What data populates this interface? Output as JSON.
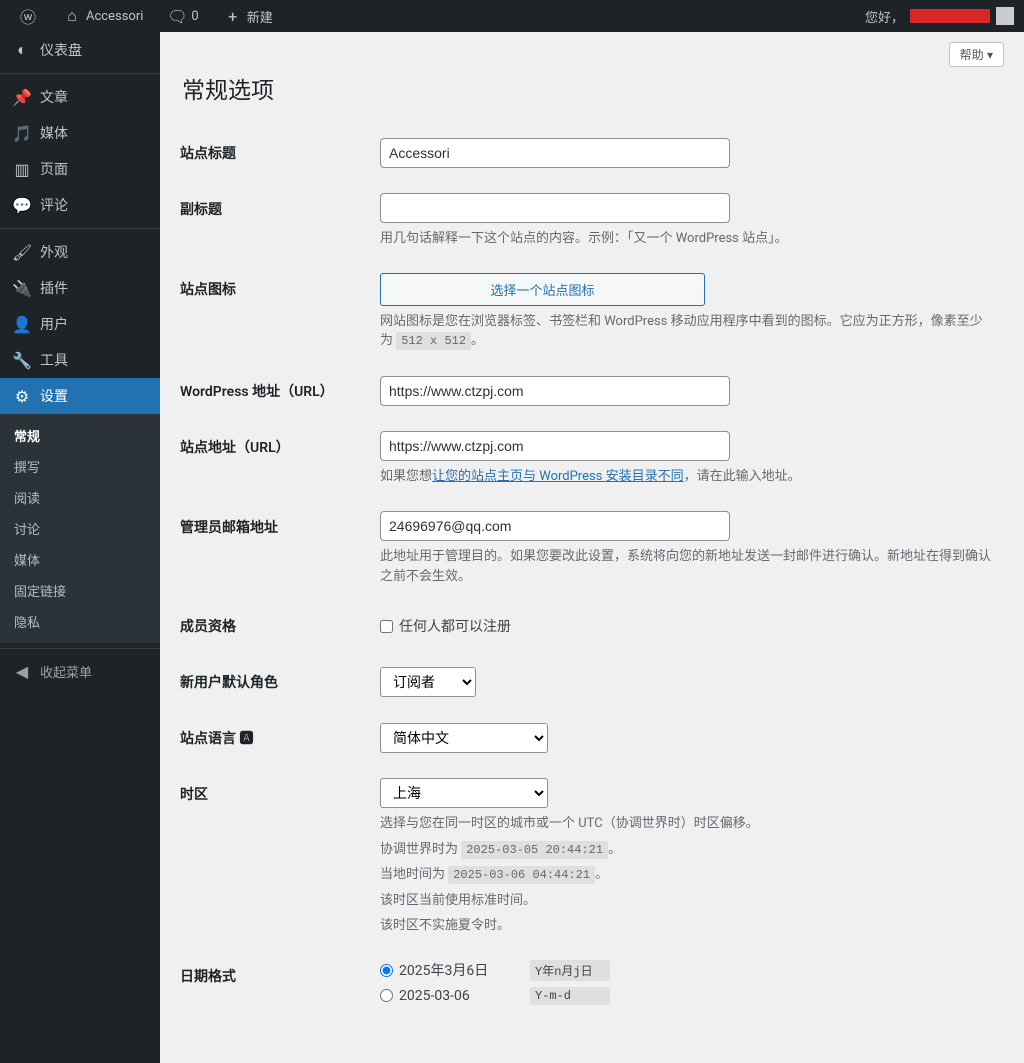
{
  "toolbar": {
    "site_name": "Accessori",
    "comments": "0",
    "new": "新建",
    "hello": "您好，"
  },
  "sidebar": {
    "items": [
      {
        "label": "仪表盘",
        "icon": "◐"
      },
      {
        "label": "文章",
        "icon": "✎"
      },
      {
        "label": "媒体",
        "icon": "✿"
      },
      {
        "label": "页面",
        "icon": "▥"
      },
      {
        "label": "评论",
        "icon": "✉"
      },
      {
        "label": "外观",
        "icon": "✦"
      },
      {
        "label": "插件",
        "icon": "✖"
      },
      {
        "label": "用户",
        "icon": "☺"
      },
      {
        "label": "工具",
        "icon": "✂"
      },
      {
        "label": "设置",
        "icon": "⚙"
      }
    ],
    "submenu": [
      "常规",
      "撰写",
      "阅读",
      "讨论",
      "媒体",
      "固定链接",
      "隐私"
    ],
    "collapse": "收起菜单"
  },
  "help_label": "帮助",
  "page_title": "常规选项",
  "fields": {
    "site_title": {
      "label": "站点标题",
      "value": "Accessori"
    },
    "tagline": {
      "label": "副标题",
      "value": "",
      "desc": "用几句话解释一下这个站点的内容。示例：「又一个 WordPress 站点」。"
    },
    "site_icon": {
      "label": "站点图标",
      "button": "选择一个站点图标",
      "desc_before": "网站图标是您在浏览器标签、书签栏和 WordPress 移动应用程序中看到的图标。它应为正方形，像素至少为 ",
      "desc_code": "512 x 512",
      "desc_after": "。"
    },
    "wp_url": {
      "label": "WordPress 地址（URL）",
      "value": "https://www.ctzpj.com"
    },
    "site_url": {
      "label": "站点地址（URL）",
      "value": "https://www.ctzpj.com",
      "desc_before": "如果您想",
      "desc_link": "让您的站点主页与 WordPress 安装目录不同",
      "desc_after": "，请在此输入地址。"
    },
    "admin_email": {
      "label": "管理员邮箱地址",
      "value": "24696976@qq.com",
      "desc": "此地址用于管理目的。如果您要改此设置，系统将向您的新地址发送一封邮件进行确认。新地址在得到确认之前不会生效。"
    },
    "membership": {
      "label": "成员资格",
      "checkbox": "任何人都可以注册"
    },
    "default_role": {
      "label": "新用户默认角色",
      "value": "订阅者"
    },
    "site_lang": {
      "label": "站点语言",
      "value": "简体中文"
    },
    "timezone": {
      "label": "时区",
      "value": "上海",
      "desc": "选择与您在同一时区的城市或一个 UTC（协调世界时）时区偏移。",
      "utc_label": "协调世界时为 ",
      "utc_code": "2025-03-05 20:44:21",
      "utc_after": "。",
      "local_label": "当地时间为 ",
      "local_code": "2025-03-06 04:44:21",
      "local_after": "。",
      "dst1": "该时区当前使用标准时间。",
      "dst2": "该时区不实施夏令时。"
    },
    "date_format": {
      "label": "日期格式",
      "options": [
        {
          "display": "2025年3月6日",
          "code": "Y年n月j日",
          "checked": true
        },
        {
          "display": "2025-03-06",
          "code": "Y-m-d",
          "checked": false
        }
      ]
    }
  }
}
